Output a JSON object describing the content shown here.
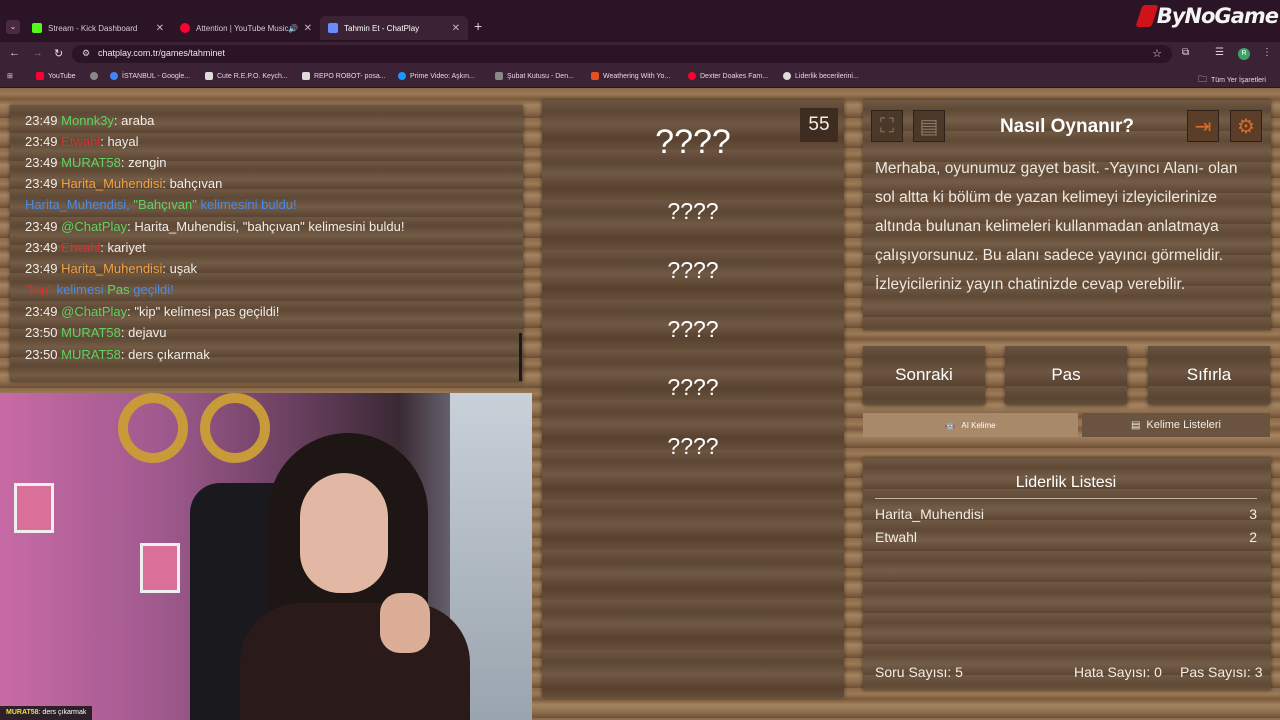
{
  "browser": {
    "tabs": [
      {
        "label": "Stream - Kick Dashboard",
        "color": "#53fc18"
      },
      {
        "label": "Attention | YouTube Music",
        "color": "#ff0033"
      },
      {
        "label": "Tahmin Et - ChatPlay",
        "color": "#6a8aff"
      }
    ],
    "url": "chatplay.com.tr/games/tahminet",
    "bookmarks": [
      {
        "label": "YouTube",
        "color": "#ff0033"
      },
      {
        "label": "",
        "color": "#888888"
      },
      {
        "label": "İSTANBUL - Google...",
        "color": "#4285f4"
      },
      {
        "label": "Cute R.E.P.O. Keych...",
        "color": "#dddddd"
      },
      {
        "label": "REPO ROBOT- posa...",
        "color": "#dddddd"
      },
      {
        "label": "Prime Video: Aşkın...",
        "color": "#1a98ff"
      },
      {
        "label": "Şubat Kutusu - Den...",
        "color": "#888888"
      },
      {
        "label": "Weathering With Yo...",
        "color": "#e05020"
      },
      {
        "label": "Dexter Doakes Fam...",
        "color": "#ff0033"
      },
      {
        "label": "Liderlik becerilerini...",
        "color": "#dddddd"
      }
    ],
    "all_bookmarks": "Tüm Yer İşaretleri",
    "profile_initial": "R"
  },
  "logo": "ByNoGame",
  "chat": {
    "messages": [
      {
        "time": "23:49",
        "user": "Monnk3y",
        "user_color": "green",
        "sep": ": ",
        "text": "araba"
      },
      {
        "time": "23:49",
        "user": "Etwahl",
        "user_color": "red",
        "sep": ": ",
        "text": "hayal"
      },
      {
        "time": "23:49",
        "user": "MURAT58",
        "user_color": "green",
        "sep": ": ",
        "text": "zengin"
      },
      {
        "time": "23:49",
        "user": "Harita_Muhendisi",
        "user_color": "orange",
        "sep": ": ",
        "text": "bahçıvan"
      },
      {
        "system": "found",
        "user": "Harita_Muhendisi",
        "word": "\"Bahçıvan\"",
        "text": " kelimesini buldu!"
      },
      {
        "time": "23:49",
        "user": "@ChatPlay",
        "user_color": "green",
        "sep": ": ",
        "text": "Harita_Muhendisi, \"bahçıvan\" kelimesini buldu!"
      },
      {
        "time": "23:49",
        "user": "Etwahl",
        "user_color": "red",
        "sep": ": ",
        "text": "kariyet"
      },
      {
        "time": "23:49",
        "user": "Harita_Muhendisi",
        "user_color": "orange",
        "sep": ": ",
        "text": "uşak"
      },
      {
        "system": "pass",
        "word": "\"Kip\"",
        "text1": " kelimesi ",
        "pas": "Pas",
        "text2": " geçildi!"
      },
      {
        "time": "23:49",
        "user": "@ChatPlay",
        "user_color": "green",
        "sep": ": ",
        "text": "\"kip\" kelimesi pas geçildi!"
      },
      {
        "time": "23:50",
        "user": "MURAT58",
        "user_color": "green",
        "sep": ": ",
        "text": "dejavu"
      },
      {
        "time": "23:50",
        "user": "MURAT58",
        "user_color": "green",
        "sep": ": ",
        "text": "ders çıkarmak"
      }
    ]
  },
  "ticker": {
    "user": "MURAT58",
    "text": ": ders çıkarmak"
  },
  "game": {
    "timer": "55",
    "words": [
      "????",
      "????",
      "????",
      "????",
      "????",
      "????"
    ]
  },
  "howto": {
    "title": "Nasıl Oynanır?",
    "text": "Merhaba, oyunumuz gayet basit. -Yayıncı Alanı- olan sol altta ki bölüm de yazan kelimeyi izleyicilerinize altında bulunan kelimeleri kullanmadan anlatmaya çalışıyorsunuz. Bu alanı sadece yayıncı görmelidir. İzleyicileriniz yayın chatinizde cevap verebilir."
  },
  "controls": {
    "next": "Sonraki",
    "pass": "Pas",
    "reset": "Sıfırla",
    "ai_word": "AI Kelime",
    "word_lists": "Kelime Listeleri"
  },
  "leaderboard": {
    "title": "Liderlik Listesi",
    "rows": [
      {
        "name": "Harita_Muhendisi",
        "score": "3"
      },
      {
        "name": "Etwahl",
        "score": "2"
      }
    ]
  },
  "stats": {
    "questions": "Soru Sayısı: 5",
    "errors": "Hata Sayısı: 0",
    "passes": "Pas Sayısı: 3"
  }
}
